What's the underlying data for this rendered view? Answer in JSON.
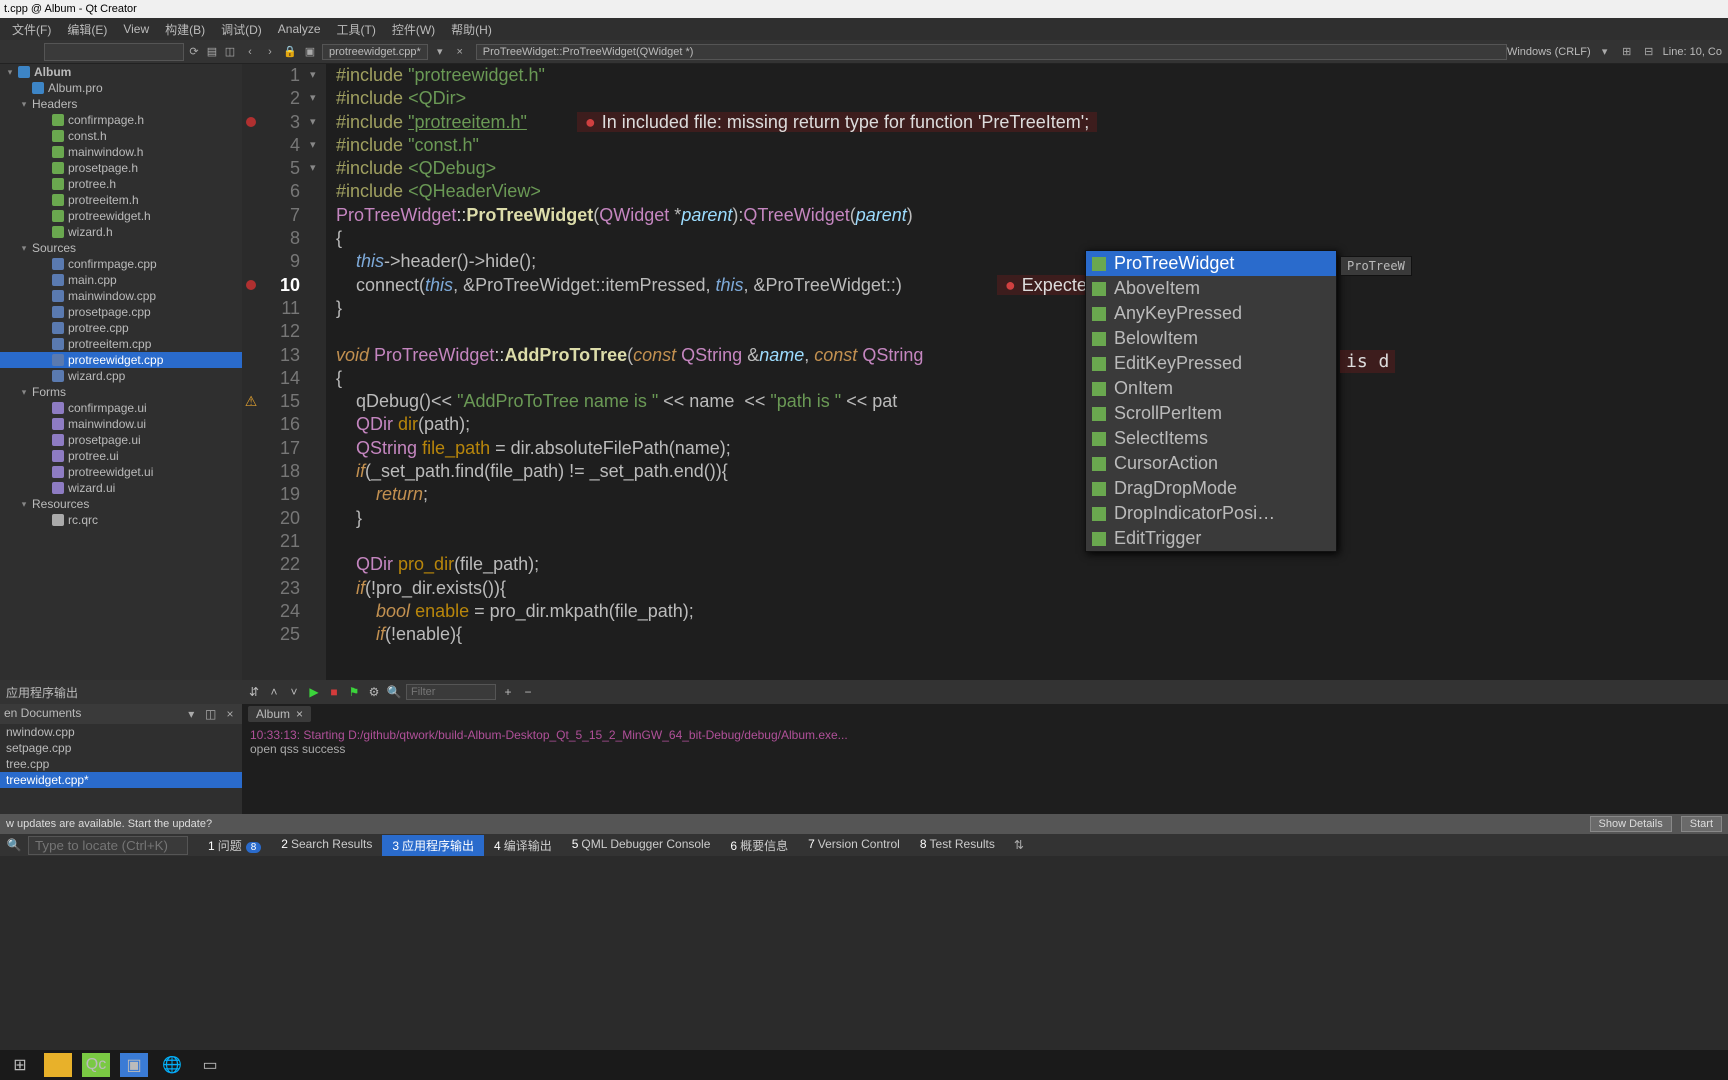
{
  "titlebar": "t.cpp @ Album - Qt Creator",
  "menus": [
    "文件(F)",
    "编辑(E)",
    "View",
    "构建(B)",
    "调试(D)",
    "Analyze",
    "工具(T)",
    "控件(W)",
    "帮助(H)"
  ],
  "toolbar": {
    "file_tab": "protreewidget.cpp*",
    "symbol_tab": "ProTreeWidget::ProTreeWidget(QWidget *)",
    "line_ending": "Windows (CRLF)",
    "cursor": "Line: 10, Co"
  },
  "project_tree": {
    "root": "Album",
    "nodes": [
      {
        "depth": 1,
        "label": "Album.pro",
        "icon": "pro"
      },
      {
        "depth": 1,
        "label": "Headers",
        "expandable": true
      },
      {
        "depth": 2,
        "label": "confirmpage.h",
        "icon": "h"
      },
      {
        "depth": 2,
        "label": "const.h",
        "icon": "h"
      },
      {
        "depth": 2,
        "label": "mainwindow.h",
        "icon": "h"
      },
      {
        "depth": 2,
        "label": "prosetpage.h",
        "icon": "h"
      },
      {
        "depth": 2,
        "label": "protree.h",
        "icon": "h"
      },
      {
        "depth": 2,
        "label": "protreeitem.h",
        "icon": "h"
      },
      {
        "depth": 2,
        "label": "protreewidget.h",
        "icon": "h"
      },
      {
        "depth": 2,
        "label": "wizard.h",
        "icon": "h"
      },
      {
        "depth": 1,
        "label": "Sources",
        "expandable": true
      },
      {
        "depth": 2,
        "label": "confirmpage.cpp",
        "icon": "cpp"
      },
      {
        "depth": 2,
        "label": "main.cpp",
        "icon": "cpp"
      },
      {
        "depth": 2,
        "label": "mainwindow.cpp",
        "icon": "cpp"
      },
      {
        "depth": 2,
        "label": "prosetpage.cpp",
        "icon": "cpp"
      },
      {
        "depth": 2,
        "label": "protree.cpp",
        "icon": "cpp"
      },
      {
        "depth": 2,
        "label": "protreeitem.cpp",
        "icon": "cpp"
      },
      {
        "depth": 2,
        "label": "protreewidget.cpp",
        "icon": "cpp",
        "selected": true
      },
      {
        "depth": 2,
        "label": "wizard.cpp",
        "icon": "cpp"
      },
      {
        "depth": 1,
        "label": "Forms",
        "expandable": true
      },
      {
        "depth": 2,
        "label": "confirmpage.ui",
        "icon": "ui"
      },
      {
        "depth": 2,
        "label": "mainwindow.ui",
        "icon": "ui"
      },
      {
        "depth": 2,
        "label": "prosetpage.ui",
        "icon": "ui"
      },
      {
        "depth": 2,
        "label": "protree.ui",
        "icon": "ui"
      },
      {
        "depth": 2,
        "label": "protreewidget.ui",
        "icon": "ui"
      },
      {
        "depth": 2,
        "label": "wizard.ui",
        "icon": "ui"
      },
      {
        "depth": 1,
        "label": "Resources",
        "expandable": true
      },
      {
        "depth": 2,
        "label": "rc.qrc",
        "icon": "qrc"
      }
    ]
  },
  "code": {
    "lines": [
      {
        "n": 1,
        "html": "<span class='pp'>#include</span> <span class='str'>\"protreewidget.h\"</span>"
      },
      {
        "n": 2,
        "html": "<span class='pp'>#include</span> <span class='str'>&lt;QDir&gt;</span>"
      },
      {
        "n": 3,
        "mark": "bp",
        "html": "<span class='pp'>#include</span> <span class='str u'>\"protreeitem.h\"</span>      <span class='inline-err'>In included file: missing return type for function 'PreTreeItem';</span>"
      },
      {
        "n": 4,
        "html": "<span class='pp'>#include</span> <span class='str'>\"const.h\"</span>"
      },
      {
        "n": 5,
        "html": "<span class='pp'>#include</span> <span class='str'>&lt;QDebug&gt;</span>"
      },
      {
        "n": 6,
        "html": "<span class='pp'>#include</span> <span class='str'>&lt;QHeaderView&gt;</span>"
      },
      {
        "n": 7,
        "fold": "▾",
        "html": "<span class='ty'>ProTreeWidget</span><span class='op'>::</span><span class='fn'>ProTreeWidget</span>(<span class='ty'>QWidget</span> *<span class='par'>parent</span>):<span class='ty'>QTreeWidget</span>(<span class='par'>parent</span>)"
      },
      {
        "n": 8,
        "html": "{"
      },
      {
        "n": 9,
        "html": "    <span class='th'>this</span>-&gt;header()-&gt;hide();"
      },
      {
        "n": 10,
        "mark": "bp",
        "cur": true,
        "html": "    connect(<span class='th'>this</span>, &amp;ProTreeWidget::itemPressed, <span class='th'>this</span>, &amp;ProTreeWidget::)               <span class='inline-err'>Expected unqualif</span>"
      },
      {
        "n": 11,
        "html": "}"
      },
      {
        "n": 12,
        "html": ""
      },
      {
        "n": 13,
        "fold": "▾",
        "html": "<span class='kw'>void</span> <span class='ty'>ProTreeWidget</span><span class='op'>::</span><span class='fn'>AddProToTree</span>(<span class='kw'>const</span> <span class='ty'>QString</span> &amp;<span class='par'>name</span>, <span class='kw'>const</span> <span class='ty'>QString</span>"
      },
      {
        "n": 14,
        "html": "{"
      },
      {
        "n": 15,
        "mark": "warn",
        "html": "    qDebug()&lt;&lt; <span class='str'>\"AddProToTree name is \"</span> &lt;&lt; name  &lt;&lt; <span class='str'>\"path is \"</span> &lt;&lt; pat"
      },
      {
        "n": 16,
        "html": "    <span class='ty'>QDir</span> <span class='var'>dir</span>(path);"
      },
      {
        "n": 17,
        "html": "    <span class='ty'>QString</span> <span class='var'>file_path</span> = dir.absoluteFilePath(name);"
      },
      {
        "n": 18,
        "fold": "▾",
        "html": "    <span class='kw'>if</span>(_set_path.find(file_path) != _set_path.end()){"
      },
      {
        "n": 19,
        "html": "        <span class='kw'>return</span>;"
      },
      {
        "n": 20,
        "html": "    }"
      },
      {
        "n": 21,
        "html": ""
      },
      {
        "n": 22,
        "html": "    <span class='ty'>QDir</span> <span class='var'>pro_dir</span>(file_path);"
      },
      {
        "n": 23,
        "fold": "▾",
        "html": "    <span class='kw'>if</span>(!pro_dir.exists()){"
      },
      {
        "n": 24,
        "html": "        <span class='kw'>bool</span> <span class='var'>enable</span> = pro_dir.mkpath(file_path);"
      },
      {
        "n": 25,
        "fold": "▾",
        "html": "        <span class='kw'>if</span>(!enable){"
      }
    ],
    "side_hint": "is d"
  },
  "autocomplete": {
    "tip": "ProTreeW",
    "items": [
      {
        "label": "ProTreeWidget",
        "selected": true
      },
      {
        "label": "AboveItem"
      },
      {
        "label": "AnyKeyPressed"
      },
      {
        "label": "BelowItem"
      },
      {
        "label": "EditKeyPressed"
      },
      {
        "label": "OnItem"
      },
      {
        "label": "ScrollPerItem"
      },
      {
        "label": "SelectItems"
      },
      {
        "label": "CursorAction"
      },
      {
        "label": "DragDropMode"
      },
      {
        "label": "DropIndicatorPosi…"
      },
      {
        "label": "EditTrigger"
      }
    ]
  },
  "output": {
    "header": "应用程序输出",
    "filter_placeholder": "Filter",
    "docs_header": "en Documents",
    "docs": [
      {
        "label": "nwindow.cpp"
      },
      {
        "label": "setpage.cpp"
      },
      {
        "label": "tree.cpp"
      },
      {
        "label": "treewidget.cpp*",
        "selected": true
      }
    ],
    "tab": "Album",
    "line1": "10:33:13: Starting D:/github/qtwork/build-Album-Desktop_Qt_5_15_2_MinGW_64_bit-Debug/debug/Album.exe...",
    "line2": "open qss success"
  },
  "notification": {
    "text": "w updates are available. Start the update?",
    "btn_details": "Show Details",
    "btn_start": "Start"
  },
  "statusbar": {
    "locator": "Type to locate (Ctrl+K)",
    "tabs": [
      {
        "n": "1",
        "label": "问题",
        "badge": "8"
      },
      {
        "n": "2",
        "label": "Search Results"
      },
      {
        "n": "3",
        "label": "应用程序输出",
        "active": true
      },
      {
        "n": "4",
        "label": "编译输出"
      },
      {
        "n": "5",
        "label": "QML Debugger Console"
      },
      {
        "n": "6",
        "label": "概要信息"
      },
      {
        "n": "7",
        "label": "Version Control"
      },
      {
        "n": "8",
        "label": "Test Results"
      }
    ]
  }
}
